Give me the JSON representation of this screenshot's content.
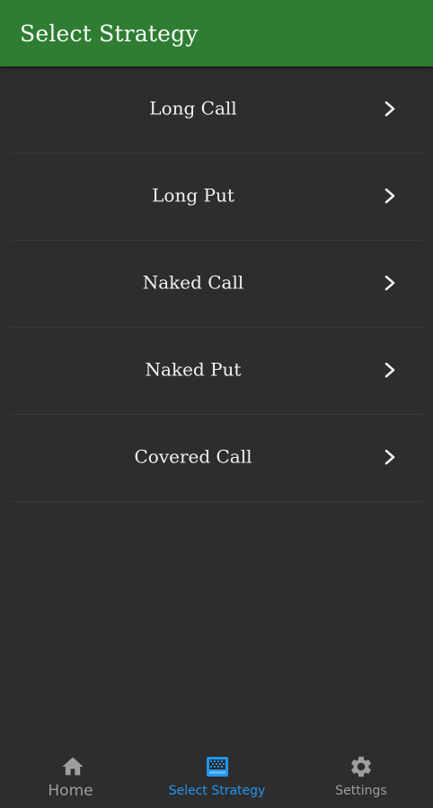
{
  "appbar": {
    "title": "Select Strategy",
    "color": "#2e7d32"
  },
  "strategies": [
    {
      "label": "Long Call",
      "icon": "chevron-right-icon"
    },
    {
      "label": "Long Put",
      "icon": "chevron-right-icon"
    },
    {
      "label": "Naked Call",
      "icon": "chevron-right-icon"
    },
    {
      "label": "Naked Put",
      "icon": "chevron-right-icon"
    },
    {
      "label": "Covered Call",
      "icon": "chevron-right-icon"
    }
  ],
  "bottom_nav": {
    "active_color": "#2196f3",
    "inactive_color": "#9e9e9e",
    "items": [
      {
        "label": "Home",
        "icon": "home-icon",
        "active": false
      },
      {
        "label": "Select Strategy",
        "icon": "strategy-icon",
        "active": true
      },
      {
        "label": "Settings",
        "icon": "gear-icon",
        "active": false
      }
    ]
  }
}
